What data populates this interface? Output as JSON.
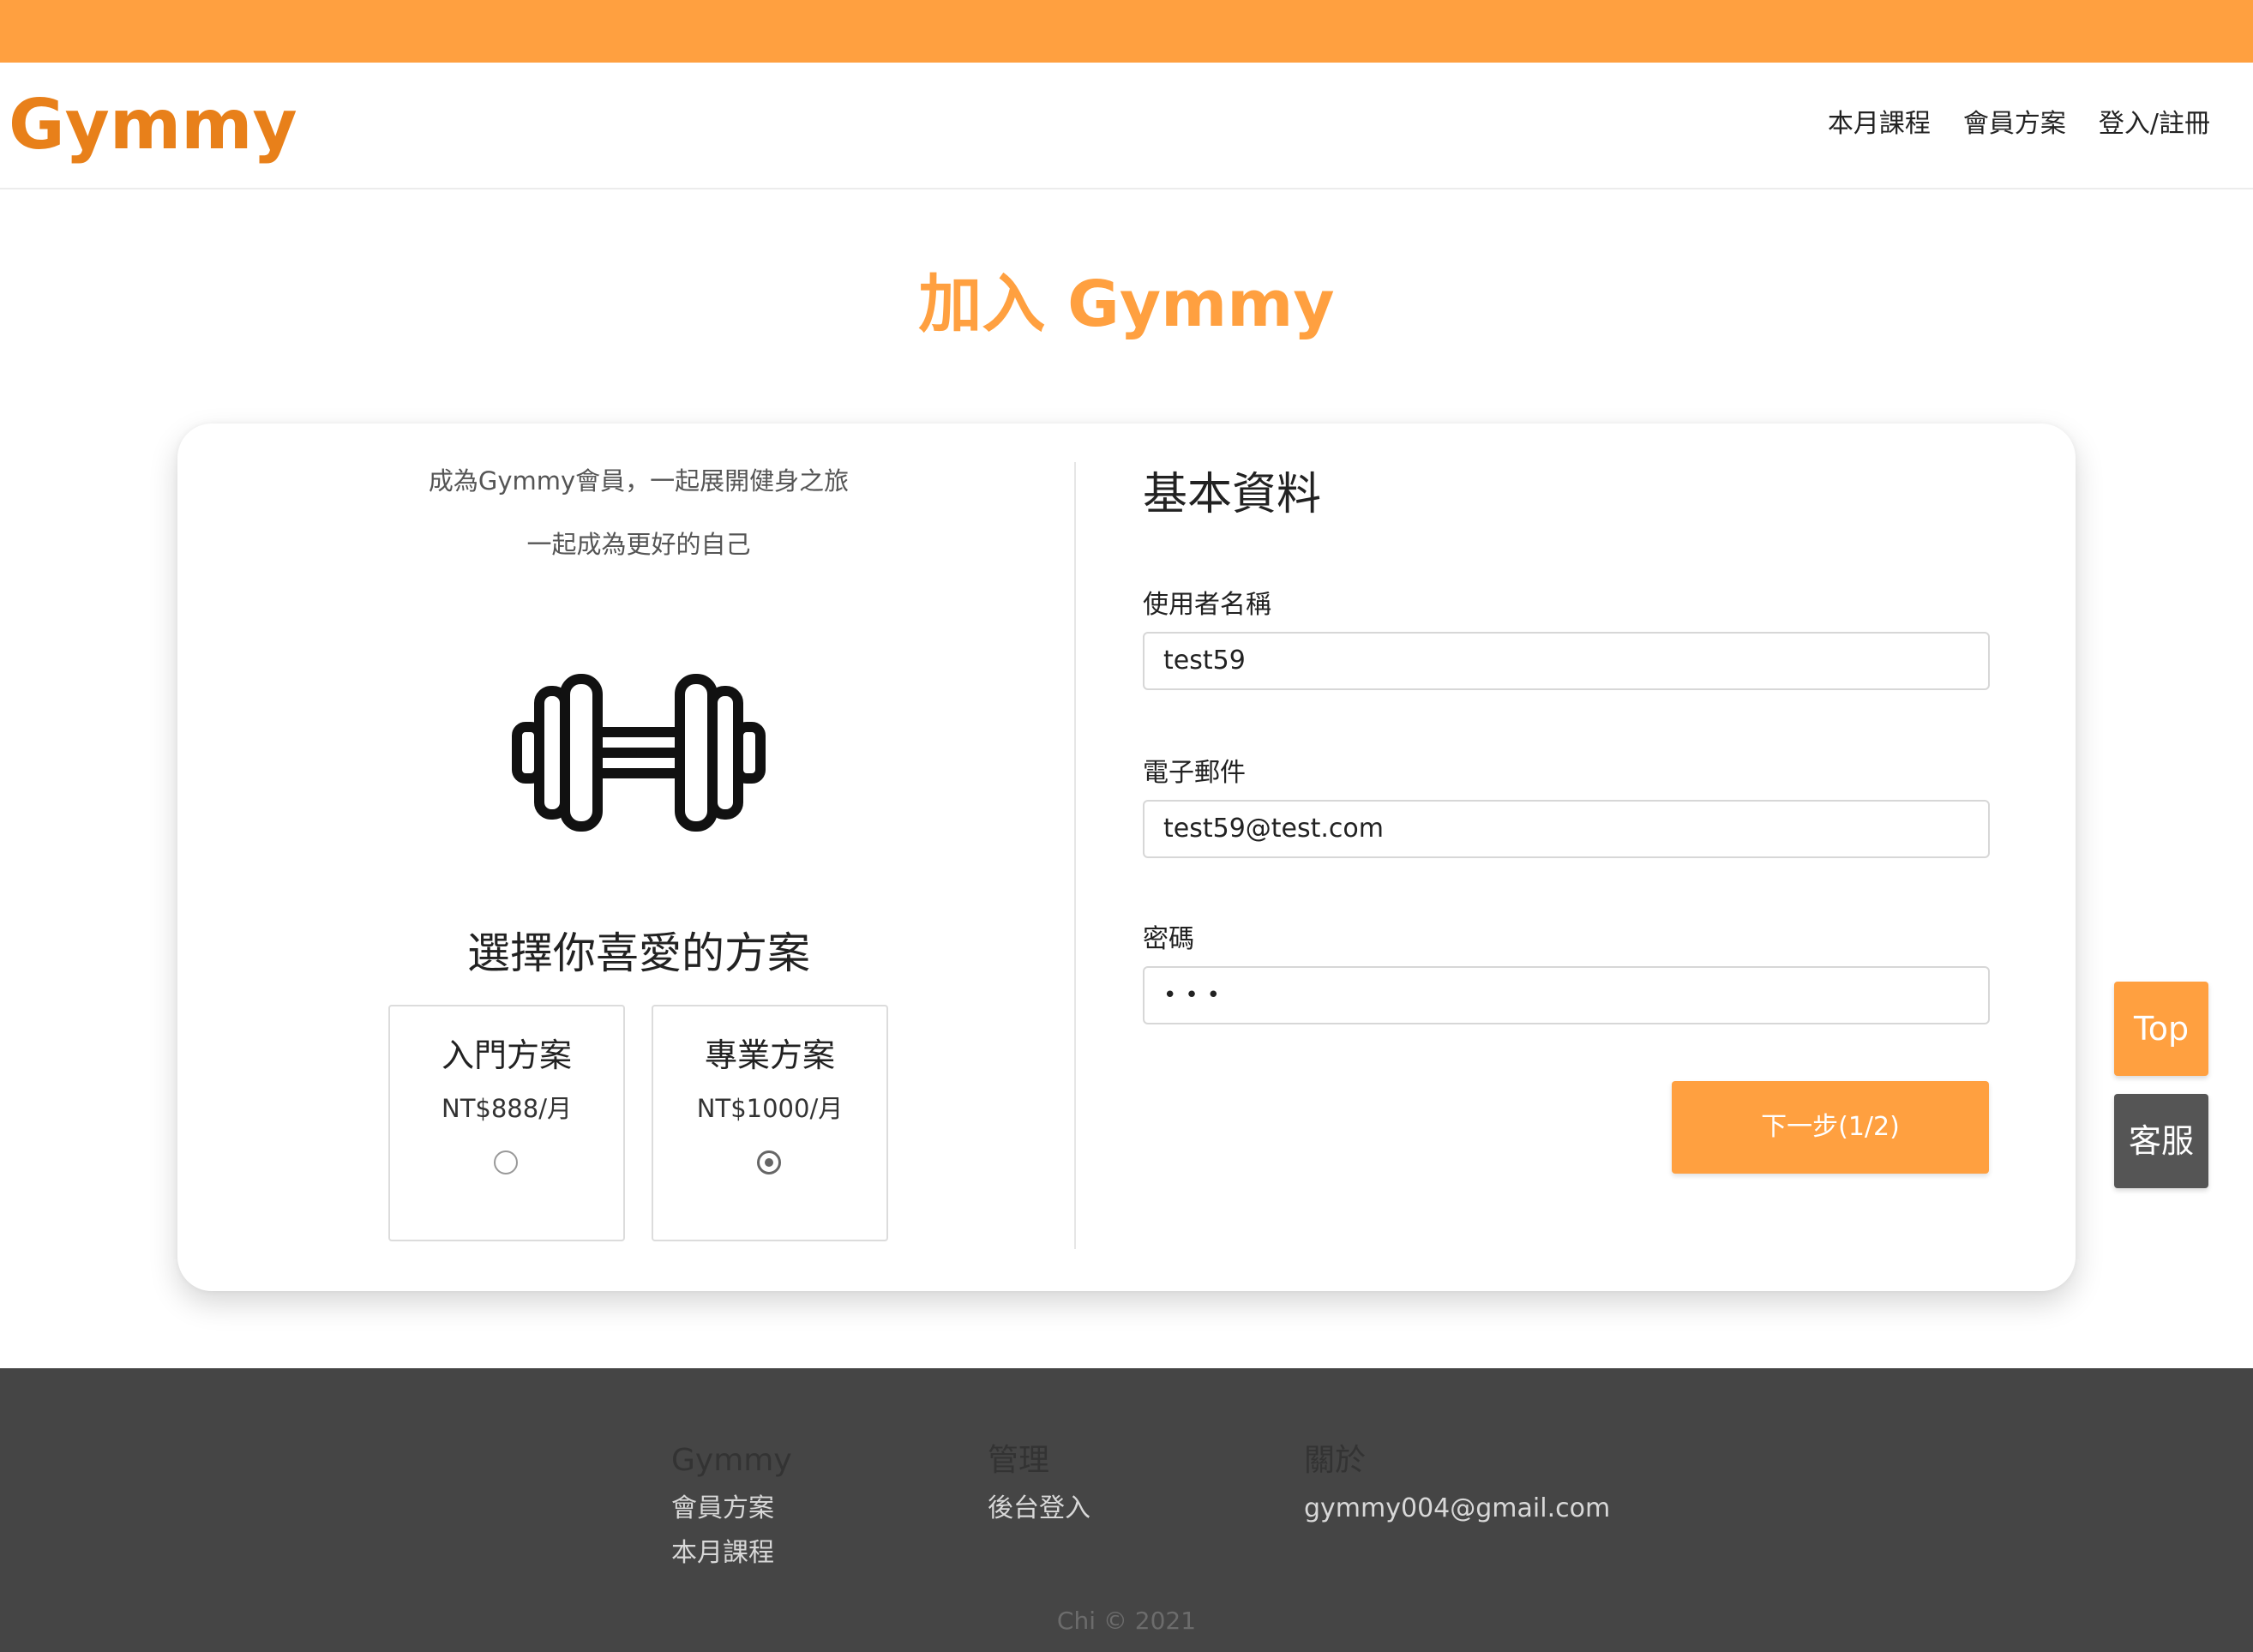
{
  "brand": {
    "logo": "Gymmy",
    "accent_color": "#ffa040"
  },
  "nav": {
    "items": [
      "本月課程",
      "會員方案",
      "登入/註冊"
    ]
  },
  "page": {
    "title": "加入 Gymmy"
  },
  "left_panel": {
    "slogan_line1": "成為Gymmy會員，一起展開健身之旅",
    "slogan_line2": "一起成為更好的自己",
    "illustration": "dumbbell-icon",
    "choose_title": "選擇你喜愛的方案",
    "plans": [
      {
        "name": "入門方案",
        "price": "NT$888/月",
        "selected": false
      },
      {
        "name": "專業方案",
        "price": "NT$1000/月",
        "selected": true
      }
    ]
  },
  "form": {
    "title": "基本資料",
    "username_label": "使用者名稱",
    "username_value": "test59",
    "email_label": "電子郵件",
    "email_value": "test59@test.com",
    "password_label": "密碼",
    "password_value": "•••",
    "next_button": "下一步(1/2)"
  },
  "side_buttons": {
    "top": "Top",
    "service": "客服"
  },
  "footer": {
    "columns": [
      {
        "heading": "Gymmy",
        "links": [
          "會員方案",
          "本月課程"
        ]
      },
      {
        "heading": "管理",
        "links": [
          "後台登入"
        ]
      },
      {
        "heading": "關於",
        "links": [
          "gymmy004@gmail.com"
        ]
      }
    ],
    "copyright": "Chi © 2021"
  }
}
